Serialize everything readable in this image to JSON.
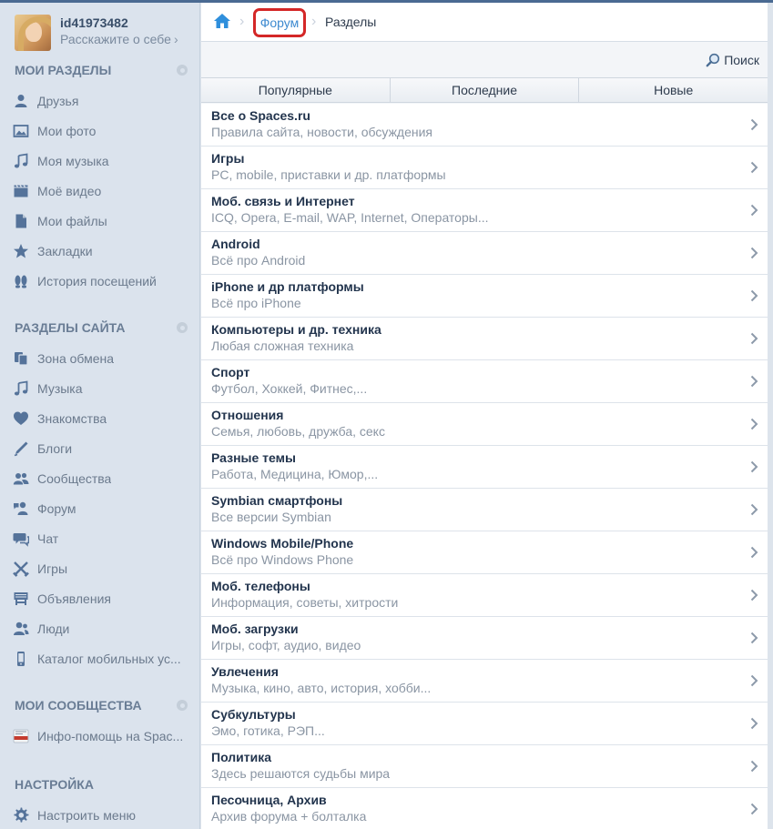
{
  "profile": {
    "name": "id41973482",
    "subtitle": "Расскажите о себе",
    "chevron": "›"
  },
  "sidebar": {
    "my_sections": {
      "title": "МОИ РАЗДЕЛЫ",
      "items": [
        {
          "label": "Друзья",
          "icon": "friend-icon"
        },
        {
          "label": "Мои фото",
          "icon": "photo-icon"
        },
        {
          "label": "Моя музыка",
          "icon": "music-icon"
        },
        {
          "label": "Моё видео",
          "icon": "video-icon"
        },
        {
          "label": "Мои файлы",
          "icon": "file-icon"
        },
        {
          "label": "Закладки",
          "icon": "star-icon"
        },
        {
          "label": "История посещений",
          "icon": "footprints-icon"
        }
      ]
    },
    "site_sections": {
      "title": "РАЗДЕЛЫ САЙТА",
      "items": [
        {
          "label": "Зона обмена",
          "icon": "exchange-icon"
        },
        {
          "label": "Музыка",
          "icon": "music-icon"
        },
        {
          "label": "Знакомства",
          "icon": "heart-icon"
        },
        {
          "label": "Блоги",
          "icon": "pen-icon"
        },
        {
          "label": "Сообщества",
          "icon": "community-icon"
        },
        {
          "label": "Форум",
          "icon": "forum-icon"
        },
        {
          "label": "Чат",
          "icon": "chat-icon"
        },
        {
          "label": "Игры",
          "icon": "games-icon"
        },
        {
          "label": "Объявления",
          "icon": "ads-icon"
        },
        {
          "label": "Люди",
          "icon": "people-icon"
        },
        {
          "label": "Каталог мобильных ус...",
          "icon": "phone-icon"
        }
      ]
    },
    "my_communities": {
      "title": "МОИ СООБЩЕСТВА",
      "items": [
        {
          "label": "Инфо-помощь на Spac...",
          "icon": "help-badge-icon"
        }
      ]
    },
    "settings": {
      "title": "НАСТРОЙКА",
      "items": [
        {
          "label": "Настроить меню",
          "icon": "gear-icon"
        }
      ]
    }
  },
  "breadcrumb": {
    "home_icon": "home-icon",
    "separator": "›",
    "forum": "Форум",
    "current": "Разделы"
  },
  "search": {
    "label": "Поиск",
    "icon": "search-icon"
  },
  "tabs": [
    "Популярные",
    "Последние",
    "Новые"
  ],
  "sections": [
    {
      "title": "Все о Spaces.ru",
      "subtitle": "Правила сайта, новости, обсуждения"
    },
    {
      "title": "Игры",
      "subtitle": "PC, mobile, приставки и др. платформы"
    },
    {
      "title": "Моб. связь и Интернет",
      "subtitle": "ICQ, Opera, E-mail, WAP, Internet, Операторы..."
    },
    {
      "title": "Android",
      "subtitle": "Всё про Android"
    },
    {
      "title": "iPhone и др платформы",
      "subtitle": "Всё про iPhone"
    },
    {
      "title": "Компьютеры и др. техника",
      "subtitle": "Любая сложная техника"
    },
    {
      "title": "Спорт",
      "subtitle": "Футбол, Хоккей, Фитнес,..."
    },
    {
      "title": "Отношения",
      "subtitle": "Семья, любовь, дружба, секс"
    },
    {
      "title": "Разные темы",
      "subtitle": "Работа, Медицина, Юмор,..."
    },
    {
      "title": "Symbian смартфоны",
      "subtitle": "Все версии Symbian"
    },
    {
      "title": "Windows Mobile/Phone",
      "subtitle": "Всё про Windows Phone"
    },
    {
      "title": "Моб. телефоны",
      "subtitle": "Информация, советы, хитрости"
    },
    {
      "title": "Моб. загрузки",
      "subtitle": "Игры, софт, аудио, видео"
    },
    {
      "title": "Увлечения",
      "subtitle": "Музыка, кино, авто, история, хобби..."
    },
    {
      "title": "Субкультуры",
      "subtitle": "Эмо, готика, РЭП..."
    },
    {
      "title": "Политика",
      "subtitle": "Здесь решаются судьбы мира"
    },
    {
      "title": "Песочница, Архив",
      "subtitle": "Архив форума + болталка"
    }
  ],
  "colors": {
    "sidebar_bg": "#dbe3ed",
    "accent_link": "#3d8ad0",
    "highlight_border": "#d42727",
    "icon_color": "#55739a"
  }
}
